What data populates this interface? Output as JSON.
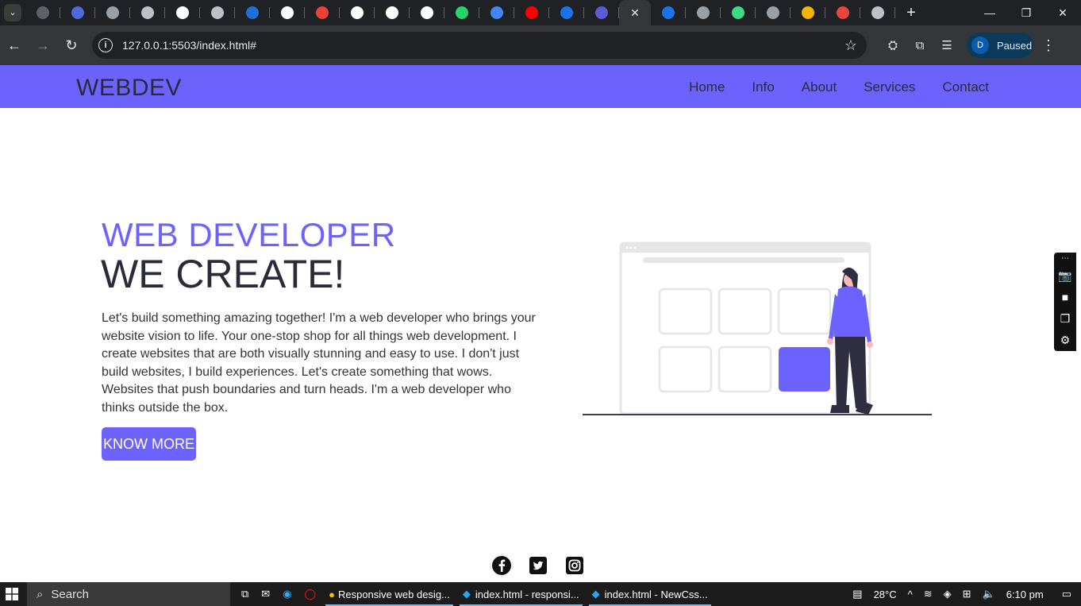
{
  "browser": {
    "url": "127.0.0.1:5503/index.html#",
    "profile_initial": "D",
    "profile_status": "Paused",
    "active_tab_close": "✕",
    "tab_favicons": [
      "#5f6368",
      "#4f6bd8",
      "#9aa0a6",
      "#bdc1c6",
      "#ffffff",
      "#bdc1c6",
      "#1f6fd8",
      "#ffffff",
      "#ea4335",
      "#ffffff",
      "#ffffff",
      "#ffffff",
      "#25d366",
      "#4285f4",
      "#ff0000",
      "#1a73e8",
      "#5b5bd6",
      "#1a73e8",
      "#9aa0a6",
      "#3ddc84",
      "#9aa0a6",
      "#f4b400",
      "#e8453c",
      "#bdc1c6"
    ]
  },
  "site": {
    "brand": "WEBDEV",
    "nav": [
      "Home",
      "Info",
      "About",
      "Services",
      "Contact"
    ],
    "hero": {
      "kicker": "WEB DEVELOPER",
      "title": "WE CREATE!",
      "text": "Let's build something amazing together! I'm a web developer who brings your website vision to life. Your one-stop shop for all things web development. I create websites that are both visually stunning and easy to use. I don't just build websites, I build experiences. Let's create something that wows. Websites that push boundaries and turn heads. I'm a web developer who thinks outside the box.",
      "button": "KNOW MORE"
    },
    "socials": [
      "facebook-icon",
      "twitter-icon",
      "instagram-icon"
    ],
    "colors": {
      "accent": "#6c63ff",
      "text": "#2b2a3a"
    }
  },
  "taskbar": {
    "search_label": "Search",
    "apps": [
      {
        "label": "Responsive web desig..."
      },
      {
        "label": "index.html - responsi..."
      },
      {
        "label": "index.html - NewCss..."
      }
    ],
    "temperature": "28°C",
    "time": "6:10 pm"
  }
}
